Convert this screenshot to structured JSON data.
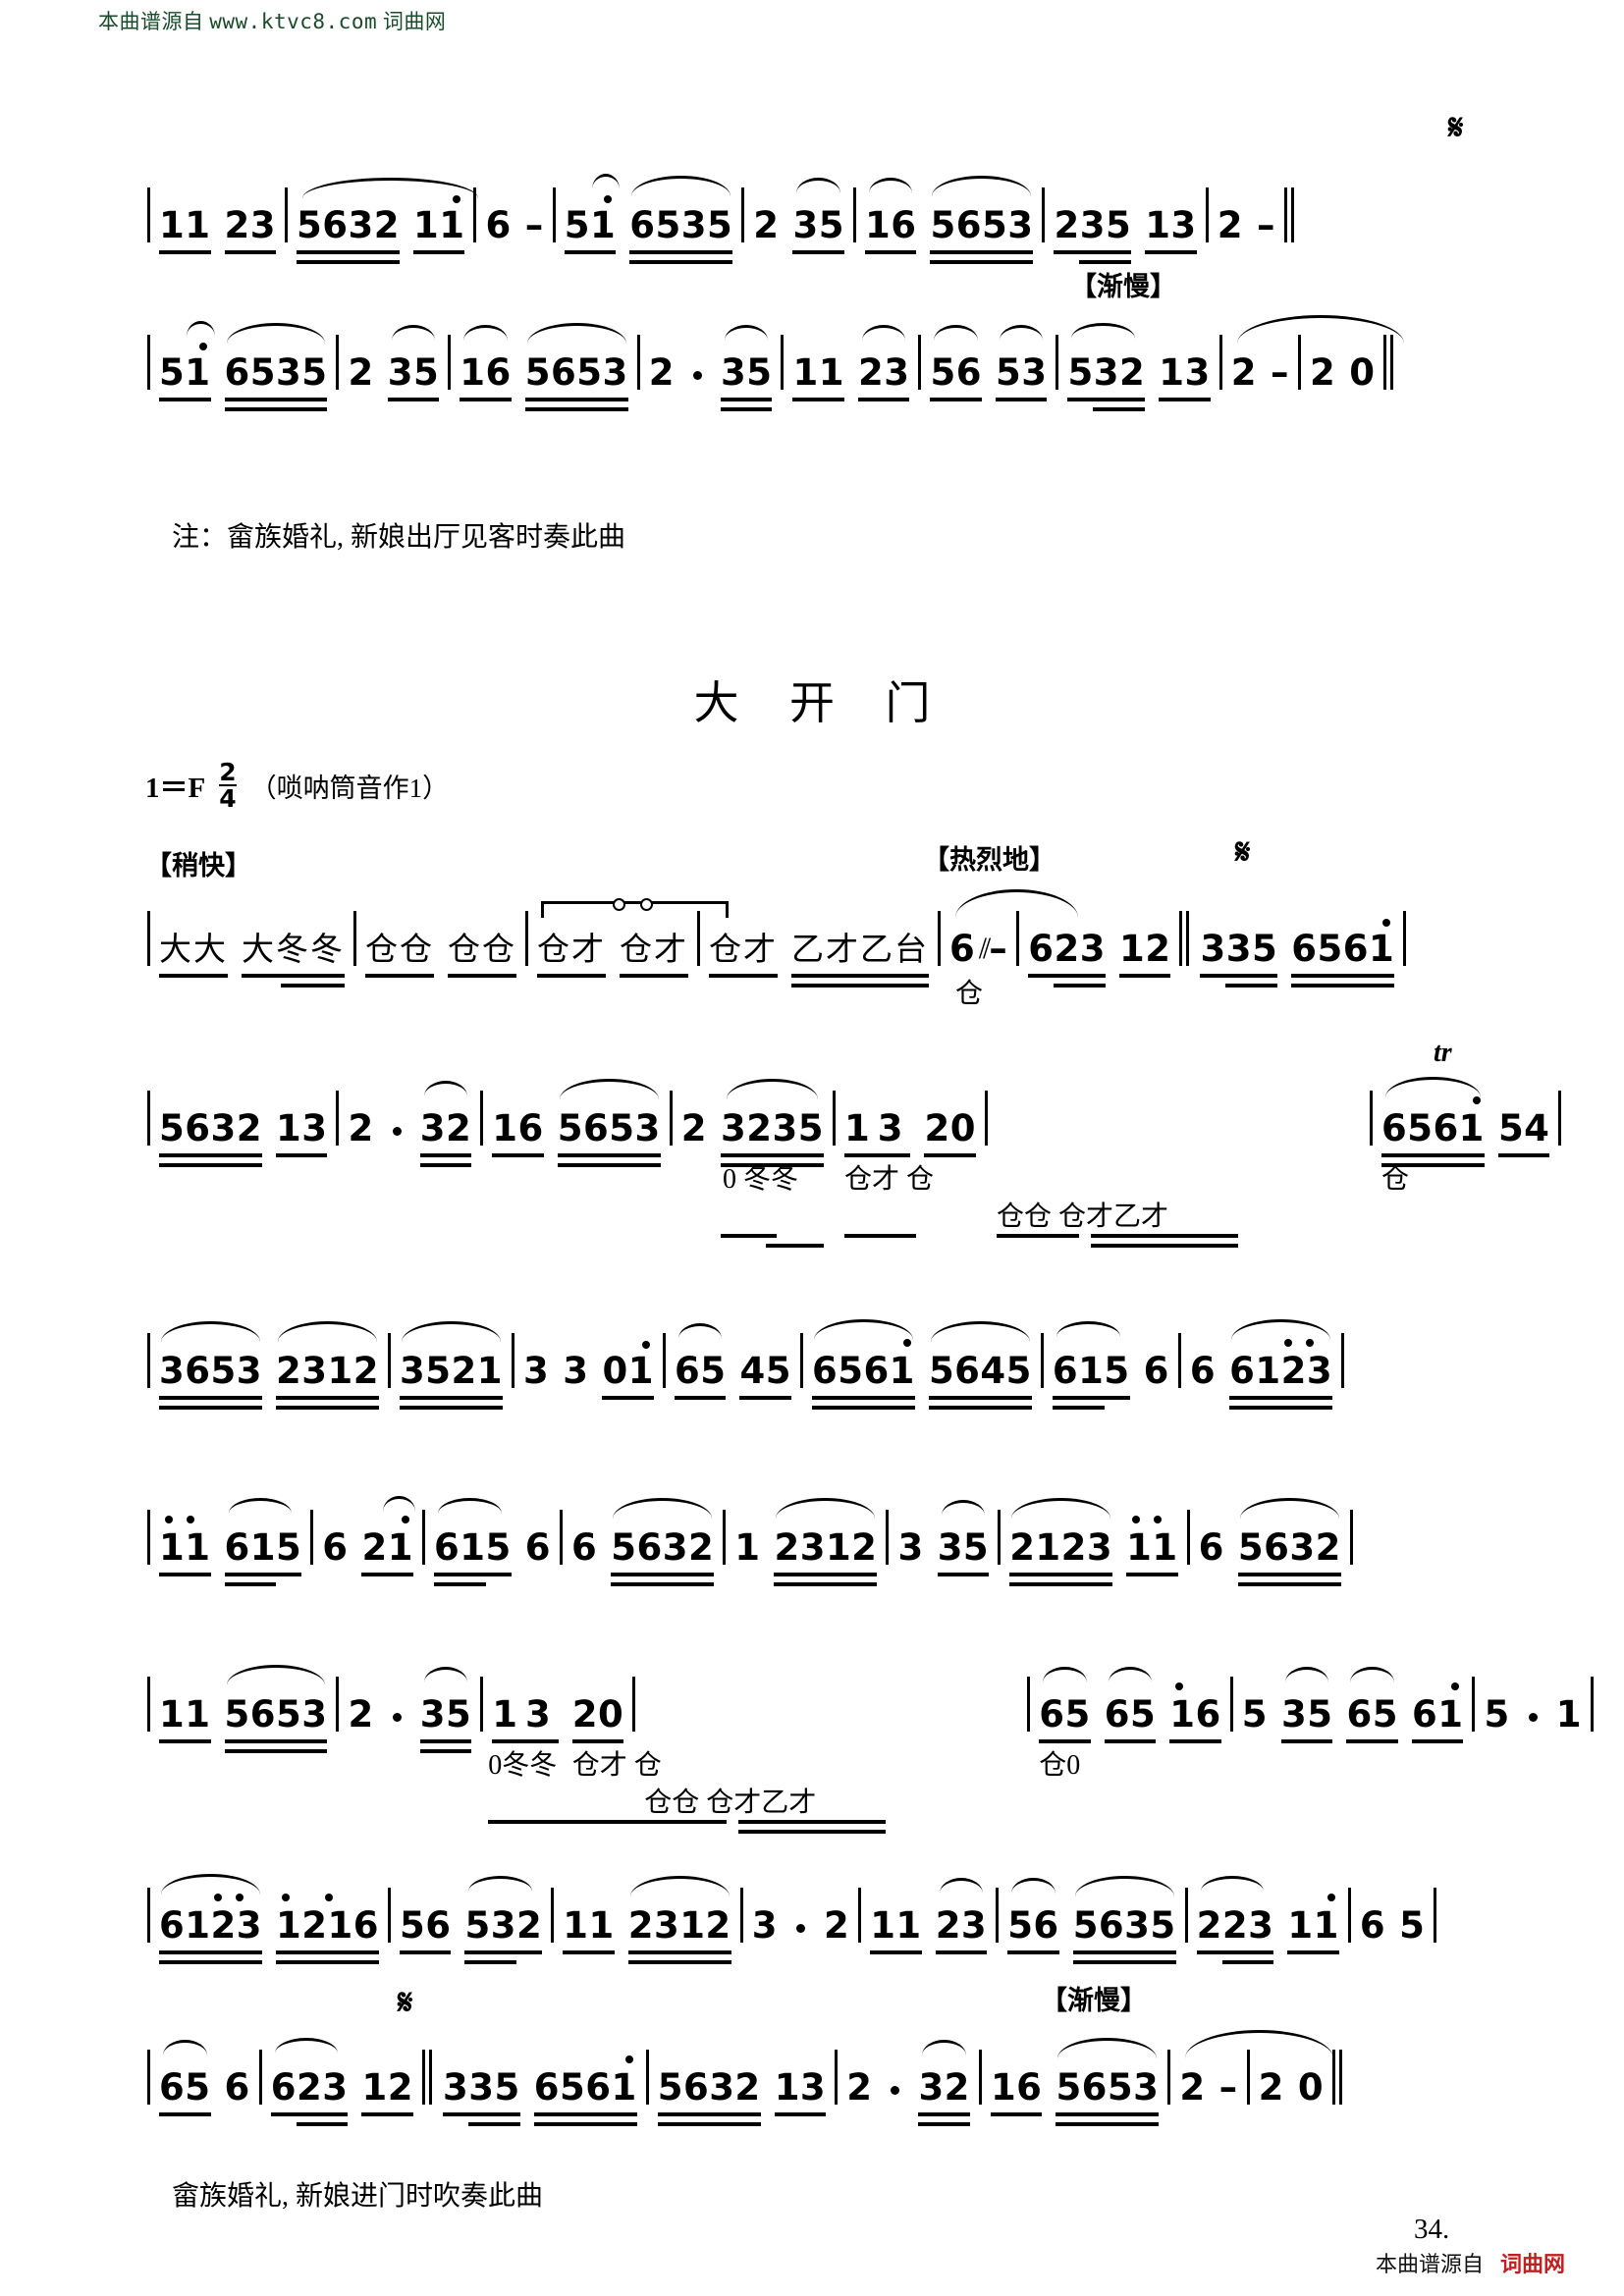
{
  "watermark": {
    "top_cn": "本曲谱源自",
    "top_url": "www.ktvc8.com",
    "top_site": "词曲网",
    "bottom_cn": "本曲谱源自",
    "bottom_site": "词曲网"
  },
  "song1": {
    "footnote": "注：畲族婚礼, 新娘出厅见客时奏此曲",
    "systems": [
      {
        "id": "s1-line1",
        "measures": [
          {
            "cells": [
              {
                "text": "11"
              },
              {
                "text": "23"
              }
            ]
          },
          {
            "cells": [
              {
                "text": "5632"
              },
              {
                "text": "11"
              }
            ]
          },
          {
            "cells": [
              {
                "text": "6"
              },
              {
                "text": "–"
              }
            ]
          },
          {
            "cells": [
              {
                "text": "51"
              },
              {
                "text": "6535"
              }
            ]
          },
          {
            "cells": [
              {
                "text": "2"
              },
              {
                "text": "35"
              }
            ]
          },
          {
            "cells": [
              {
                "text": "16"
              },
              {
                "text": "5653"
              }
            ]
          },
          {
            "cells": [
              {
                "text": "235"
              },
              {
                "text": "13"
              }
            ]
          },
          {
            "cells": [
              {
                "text": "2"
              },
              {
                "text": "–"
              }
            ]
          }
        ],
        "segno": "𝄋"
      },
      {
        "id": "s1-line2",
        "direction": "【渐慢】",
        "measures": [
          {
            "cells": [
              {
                "text": "51"
              },
              {
                "text": "6535"
              }
            ]
          },
          {
            "cells": [
              {
                "text": "2"
              },
              {
                "text": "35"
              }
            ]
          },
          {
            "cells": [
              {
                "text": "16"
              },
              {
                "text": "5653"
              }
            ]
          },
          {
            "cells": [
              {
                "text": "2"
              },
              {
                "text": "."
              },
              {
                "text": "35"
              }
            ]
          },
          {
            "cells": [
              {
                "text": "11"
              },
              {
                "text": "23"
              }
            ]
          },
          {
            "cells": [
              {
                "text": "56"
              },
              {
                "text": "53"
              }
            ]
          },
          {
            "cells": [
              {
                "text": "532"
              },
              {
                "text": "13"
              }
            ]
          },
          {
            "cells": [
              {
                "text": "2"
              },
              {
                "text": "–"
              }
            ]
          },
          {
            "cells": [
              {
                "text": "2"
              },
              {
                "text": "0"
              }
            ]
          }
        ]
      }
    ]
  },
  "song2": {
    "title": "大 开 门",
    "key": "1＝F",
    "meter_num": "2",
    "meter_den": "4",
    "instrument_note": "（唢呐筒音作1）",
    "footnote": "畲族婚礼, 新娘进门时吹奏此曲",
    "page_number": "34.",
    "directions": {
      "shaokuai": "【稍快】",
      "relieda": "【热烈地】",
      "jianman": "【渐慢】"
    },
    "trill_mark": "tr",
    "segno": "𝄋",
    "percussion_line": {
      "measures": [
        {
          "cells": [
            {
              "text": "大大"
            },
            {
              "text": "大冬冬"
            }
          ]
        },
        {
          "cells": [
            {
              "text": "仓仓"
            },
            {
              "text": "仓仓"
            }
          ]
        },
        {
          "cells": [
            {
              "text": "仓才"
            },
            {
              "text": "仓才"
            }
          ]
        },
        {
          "cells": [
            {
              "text": "仓才"
            },
            {
              "text": "乙才乙台"
            }
          ]
        }
      ]
    },
    "systems": [
      {
        "id": "s2-line1-tail",
        "measures": [
          {
            "cells": [
              {
                "text": "6",
                "syllable": "仓"
              },
              {
                "text": "–"
              }
            ]
          },
          {
            "cells": [
              {
                "text": "623"
              },
              {
                "text": "12"
              }
            ]
          },
          {
            "cells": [
              {
                "text": "335"
              },
              {
                "text": "6561"
              }
            ]
          }
        ]
      },
      {
        "id": "s2-line2",
        "measures": [
          {
            "cells": [
              {
                "text": "5632"
              },
              {
                "text": "13"
              }
            ]
          },
          {
            "cells": [
              {
                "text": "2"
              },
              {
                "text": "."
              },
              {
                "text": "32"
              }
            ]
          },
          {
            "cells": [
              {
                "text": "16"
              },
              {
                "text": "5653"
              }
            ]
          },
          {
            "cells": [
              {
                "text": "2"
              },
              {
                "text": "3235",
                "syllable": "0 冬冬"
              }
            ]
          },
          {
            "cells": [
              {
                "text": "13",
                "syllable": "仓才 仓"
              },
              {
                "text": "20"
              }
            ]
          },
          {
            "cells": [
              {
                "text": "",
                "syllable": "仓仓 仓才乙才"
              }
            ]
          },
          {
            "cells": [
              {
                "text": "6561",
                "syllable": "仓"
              },
              {
                "text": "54"
              }
            ]
          }
        ]
      },
      {
        "id": "s2-line3",
        "measures": [
          {
            "cells": [
              {
                "text": "3653"
              },
              {
                "text": "2312"
              }
            ]
          },
          {
            "cells": [
              {
                "text": "3521"
              }
            ]
          },
          {
            "cells": [
              {
                "text": "3"
              },
              {
                "text": "3"
              },
              {
                "text": "01"
              }
            ]
          },
          {
            "cells": [
              {
                "text": "65"
              },
              {
                "text": "45"
              }
            ]
          },
          {
            "cells": [
              {
                "text": "6561"
              },
              {
                "text": "5645"
              }
            ]
          },
          {
            "cells": [
              {
                "text": "615"
              },
              {
                "text": "6"
              }
            ]
          },
          {
            "cells": [
              {
                "text": "6"
              },
              {
                "text": "6123"
              }
            ]
          }
        ]
      },
      {
        "id": "s2-line4",
        "measures": [
          {
            "cells": [
              {
                "text": "11"
              },
              {
                "text": "615"
              }
            ]
          },
          {
            "cells": [
              {
                "text": "6"
              },
              {
                "text": "21"
              }
            ]
          },
          {
            "cells": [
              {
                "text": "615"
              },
              {
                "text": "6"
              }
            ]
          },
          {
            "cells": [
              {
                "text": "6"
              },
              {
                "text": "5632"
              }
            ]
          },
          {
            "cells": [
              {
                "text": "1"
              },
              {
                "text": "2312"
              }
            ]
          },
          {
            "cells": [
              {
                "text": "3"
              },
              {
                "text": "35"
              }
            ]
          },
          {
            "cells": [
              {
                "text": "2123"
              },
              {
                "text": "11"
              }
            ]
          },
          {
            "cells": [
              {
                "text": "6"
              },
              {
                "text": "5632"
              }
            ]
          }
        ]
      },
      {
        "id": "s2-line5",
        "measures": [
          {
            "cells": [
              {
                "text": "11"
              },
              {
                "text": "5653"
              }
            ]
          },
          {
            "cells": [
              {
                "text": "2"
              },
              {
                "text": "."
              },
              {
                "text": "35"
              }
            ]
          },
          {
            "cells": [
              {
                "text": "13",
                "syllable": "0冬冬"
              },
              {
                "text": "20",
                "syllable": "仓才 仓"
              }
            ]
          },
          {
            "cells": [
              {
                "text": "",
                "syllable": "仓仓 仓才乙才"
              }
            ]
          },
          {
            "cells": [
              {
                "text": "65",
                "syllable": "仓0"
              },
              {
                "text": "65"
              },
              {
                "text": "16"
              }
            ]
          },
          {
            "cells": [
              {
                "text": "5"
              },
              {
                "text": "35"
              },
              {
                "text": "65"
              },
              {
                "text": "61"
              }
            ]
          },
          {
            "cells": [
              {
                "text": "5"
              },
              {
                "text": "."
              },
              {
                "text": "1"
              }
            ]
          }
        ]
      },
      {
        "id": "s2-line6",
        "measures": [
          {
            "cells": [
              {
                "text": "6123"
              },
              {
                "text": "1216"
              }
            ]
          },
          {
            "cells": [
              {
                "text": "56"
              },
              {
                "text": "532"
              }
            ]
          },
          {
            "cells": [
              {
                "text": "11"
              },
              {
                "text": "2312"
              }
            ]
          },
          {
            "cells": [
              {
                "text": "3"
              },
              {
                "text": "."
              },
              {
                "text": "2"
              }
            ]
          },
          {
            "cells": [
              {
                "text": "11"
              },
              {
                "text": "23"
              }
            ]
          },
          {
            "cells": [
              {
                "text": "56"
              },
              {
                "text": "5635"
              }
            ]
          },
          {
            "cells": [
              {
                "text": "223"
              },
              {
                "text": "11"
              }
            ]
          },
          {
            "cells": [
              {
                "text": "6"
              },
              {
                "text": "5"
              }
            ]
          }
        ]
      },
      {
        "id": "s2-line7",
        "measures": [
          {
            "cells": [
              {
                "text": "65"
              },
              {
                "text": "6"
              }
            ]
          },
          {
            "cells": [
              {
                "text": "623"
              },
              {
                "text": "12"
              }
            ]
          },
          {
            "cells": [
              {
                "text": "335"
              },
              {
                "text": "6561"
              }
            ]
          },
          {
            "cells": [
              {
                "text": "5632"
              },
              {
                "text": "13"
              }
            ]
          },
          {
            "cells": [
              {
                "text": "2"
              },
              {
                "text": "."
              },
              {
                "text": "32"
              }
            ]
          },
          {
            "cells": [
              {
                "text": "16"
              },
              {
                "text": "5653"
              }
            ]
          },
          {
            "cells": [
              {
                "text": "2"
              },
              {
                "text": "–"
              }
            ]
          },
          {
            "cells": [
              {
                "text": "2"
              },
              {
                "text": "0"
              }
            ]
          }
        ]
      }
    ]
  }
}
